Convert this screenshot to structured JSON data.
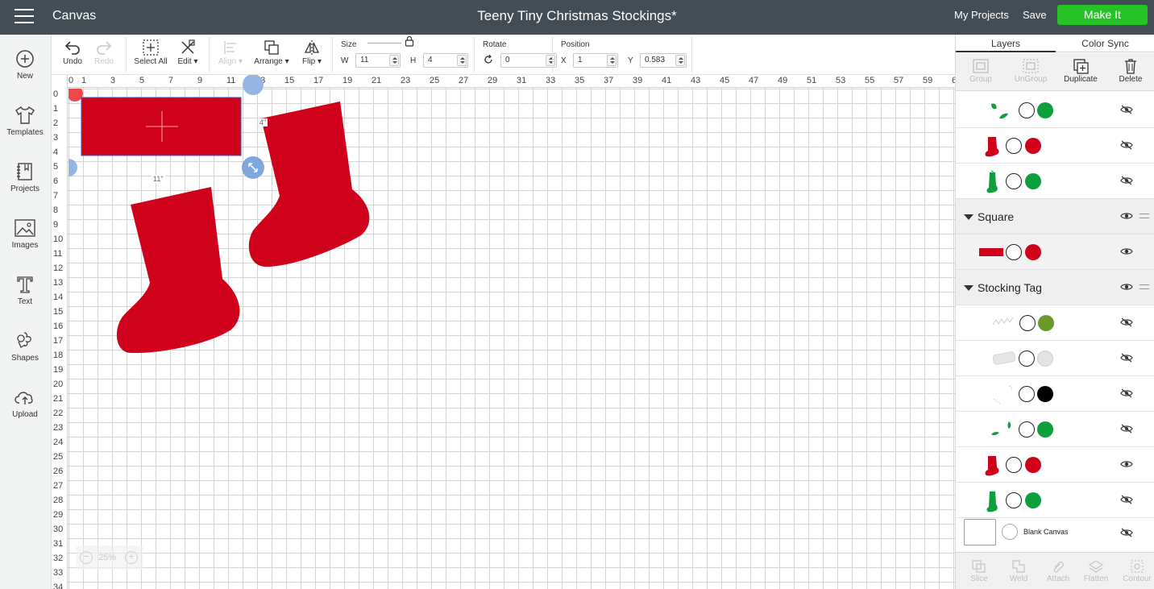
{
  "header": {
    "menu_icon": "hamburger-icon",
    "app_title": "Canvas",
    "doc_title": "Teeny Tiny Christmas Stockings*",
    "my_projects": "My Projects",
    "save": "Save",
    "make_it": "Make It",
    "make_it_color": "#25c325"
  },
  "leftbar": {
    "items": [
      {
        "label": "New",
        "icon": "plus-circle-icon"
      },
      {
        "label": "Templates",
        "icon": "tshirt-icon"
      },
      {
        "label": "Projects",
        "icon": "notebook-icon"
      },
      {
        "label": "Images",
        "icon": "image-icon"
      },
      {
        "label": "Text",
        "icon": "text-icon"
      },
      {
        "label": "Shapes",
        "icon": "shapes-icon"
      },
      {
        "label": "Upload",
        "icon": "cloud-upload-icon"
      }
    ]
  },
  "toolbar": {
    "undo": "Undo",
    "redo": "Redo",
    "select_all": "Select All",
    "edit": "Edit",
    "align": "Align",
    "arrange": "Arrange",
    "flip": "Flip",
    "size_label": "Size",
    "w_label": "W",
    "w_value": "11",
    "h_label": "H",
    "h_value": "4",
    "rotate_label": "Rotate",
    "rotate_value": "0",
    "position_label": "Position",
    "x_label": "X",
    "x_value": "1",
    "y_label": "Y",
    "y_value": "0.583"
  },
  "canvas": {
    "ruler_top": [
      "0",
      "1",
      "3",
      "5",
      "7",
      "9",
      "11",
      "13",
      "15",
      "17",
      "19",
      "21",
      "23",
      "25",
      "27",
      "29",
      "31",
      "33",
      "35",
      "37",
      "39",
      "41",
      "43",
      "45",
      "47",
      "49",
      "51",
      "53",
      "55",
      "57",
      "59",
      "6"
    ],
    "ruler_left": [
      "0",
      "1",
      "2",
      "3",
      "4",
      "5",
      "6",
      "7",
      "8",
      "9",
      "10",
      "11",
      "12",
      "13",
      "14",
      "15",
      "16",
      "17",
      "18",
      "19",
      "20",
      "21",
      "22",
      "23",
      "24",
      "25",
      "26",
      "27",
      "28",
      "29",
      "30",
      "31",
      "32",
      "33",
      "34"
    ],
    "width_label": "11\"",
    "height_label": "4\"",
    "zoom": "25%",
    "shape_color": "#d0021b"
  },
  "panel": {
    "tab_layers": "Layers",
    "tab_color_sync": "Color Sync",
    "tools": {
      "group": "Group",
      "ungroup": "UnGroup",
      "duplicate": "Duplicate",
      "delete": "Delete"
    },
    "groups": {
      "square": "Square",
      "stocking_tag": "Stocking Tag"
    },
    "colors": {
      "green": "#0e9f3d",
      "red": "#d0021b",
      "olive": "#6a9a2a",
      "light_gray": "#e3e3e3",
      "black": "#000000"
    },
    "blank_canvas": "Blank Canvas",
    "bottom_tools": {
      "slice": "Slice",
      "weld": "Weld",
      "attach": "Attach",
      "flatten": "Flatten",
      "contour": "Contour"
    }
  }
}
